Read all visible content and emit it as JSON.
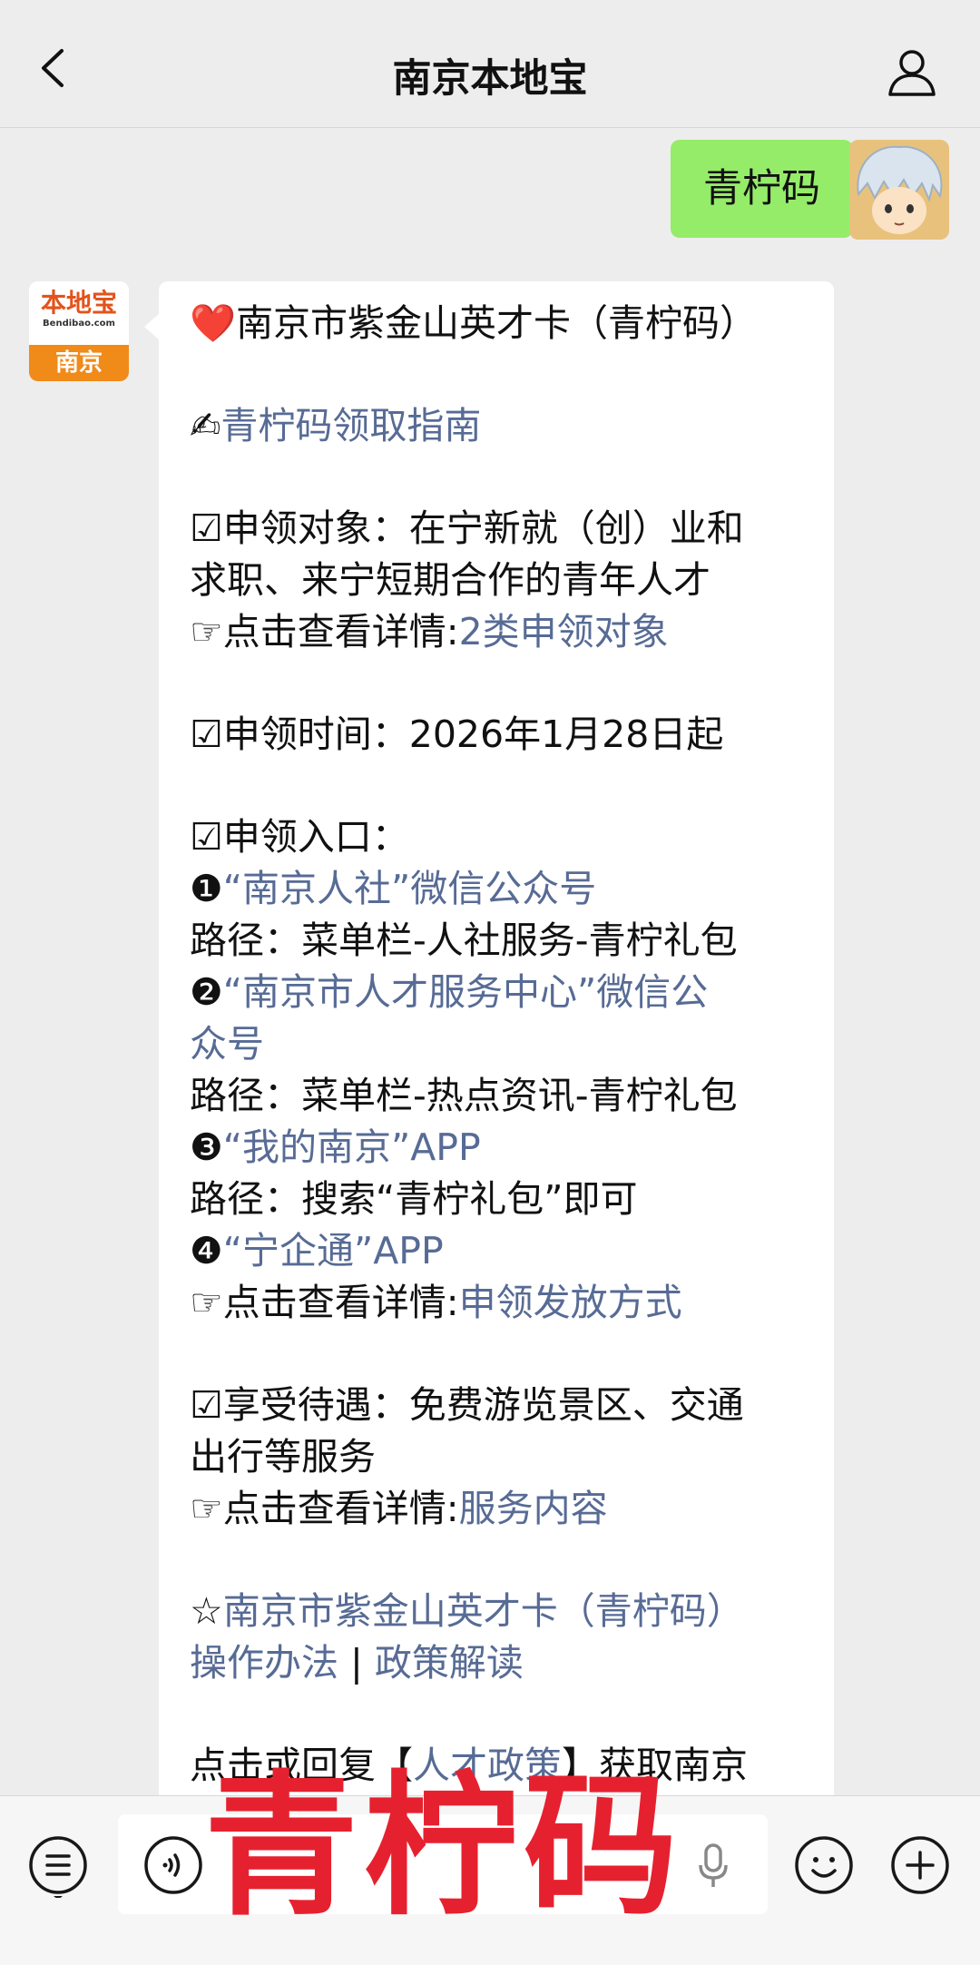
{
  "nav": {
    "title": "南京本地宝",
    "back_icon": "chevron-left-icon",
    "profile_icon": "person-icon"
  },
  "chat": {
    "outgoing": {
      "text": "青柠码"
    },
    "bot_avatar": {
      "logo_text": "本地宝",
      "logo_sub": "Bendibao.com",
      "city": "南京"
    },
    "reply": {
      "title_emoji": "❤️",
      "title": "南京市紫金山英才卡（青柠码）",
      "guide_emoji": "✍",
      "guide_link": "青柠码领取指南",
      "target_label": "☑申领对象：在宁新就（创）业和",
      "target_label_2": "求职、来宁短期合作的青年人才",
      "detail_prefix": "☞点击查看详情:",
      "target_link": "2类申领对象",
      "time_line": "☑申领时间：2026年1月28日起",
      "entry_label": "☑申领入口：",
      "entries": [
        {
          "num": "❶",
          "link": "“南京人社”微信公众号",
          "path": "路径：菜单栏-人社服务-青柠礼包"
        },
        {
          "num": "❷",
          "link_1": "“南京市人才服务中心”微信公",
          "link_2": "众号",
          "path": "路径：菜单栏-热点资讯-青柠礼包"
        },
        {
          "num": "❸",
          "link": "“我的南京”APP",
          "path": "路径：搜索“青柠礼包”即可"
        },
        {
          "num": "❹",
          "link": "“宁企通”APP"
        }
      ],
      "entry_detail_link": "申领发放方式",
      "benefit_label": "☑享受待遇：免费游览景区、交通",
      "benefit_label_2": "出行等服务",
      "benefit_link": "服务内容",
      "star_prefix": "☆",
      "policy_link_1": "南京市紫金山英才卡（青柠码）",
      "policy_link_2": "操作办法",
      "policy_sep": " | ",
      "policy_link_3": "政策解读",
      "cut_line_start": "点击或回复【",
      "cut_line_link": "人才政策",
      "cut_line_end": "】获取南京"
    }
  },
  "watermark": "青柠码",
  "bottombar": {
    "menu_icon": "menu-list-icon",
    "voice_icon": "voice-icon",
    "mic_icon": "microphone-icon",
    "emoji_icon": "emoji-icon",
    "plus_icon": "plus-icon"
  }
}
